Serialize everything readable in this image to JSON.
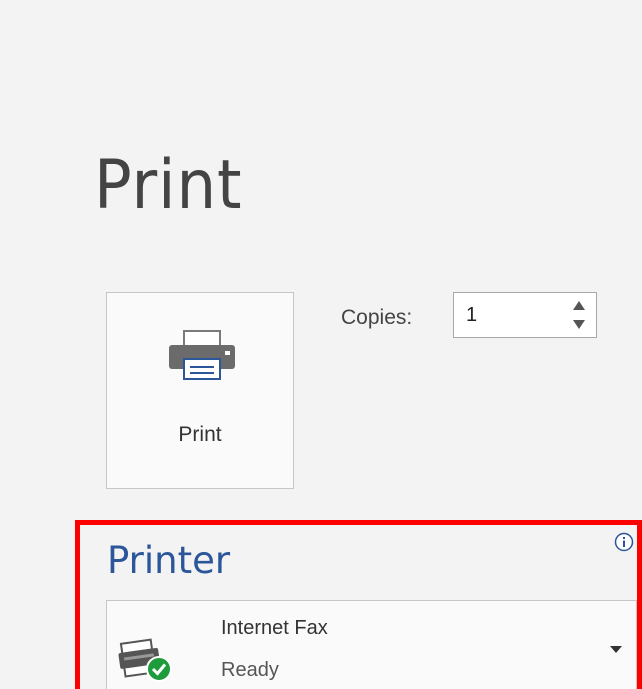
{
  "page": {
    "title": "Print"
  },
  "print_button": {
    "label": "Print",
    "icon": "printer-icon"
  },
  "copies": {
    "label": "Copies:",
    "value": "1"
  },
  "printer_section": {
    "header": "Printer",
    "info_icon": "info-icon",
    "selected_printer": {
      "name": "Internet Fax",
      "status": "Ready",
      "icon": "fax-printer-ready-icon"
    }
  },
  "colors": {
    "accent": "#2b579a",
    "highlight": "#ff0000",
    "ready_green": "#1e9b3a",
    "background": "#f3f3f3"
  }
}
